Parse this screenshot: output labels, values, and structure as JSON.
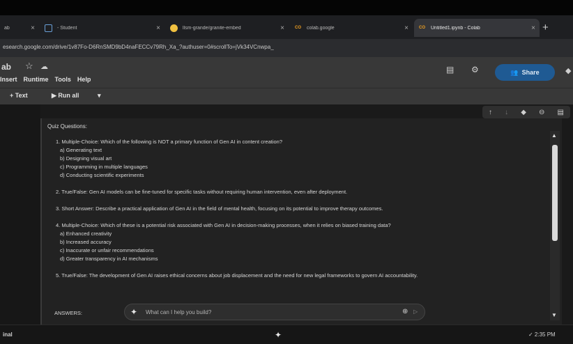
{
  "browser": {
    "tabs": [
      {
        "label": "ab",
        "icon": "tab-icon",
        "active": false
      },
      {
        "label": "- Student",
        "icon": "window-icon",
        "active": false
      },
      {
        "label": "llsm-grande/granite-embed",
        "icon": "people-icon",
        "active": false
      },
      {
        "label": "colab.google",
        "icon": "colab-icon",
        "active": false
      },
      {
        "label": "Untitled1.ipynb - Colab",
        "icon": "colab-icon",
        "active": true
      }
    ],
    "new_tab": "+",
    "url": "esearch.google.com/drive/1v87Fo-D6RnSMD9bD4naFECCv79Rh_Xa_?authuser=0#scrollTo=jVk34VCnwpa_",
    "colors": {
      "active_tab": "#35363a",
      "tabbar": "#1e1f22"
    }
  },
  "colab": {
    "brand": "ab",
    "menu": [
      "Insert",
      "Runtime",
      "Tools",
      "Help"
    ],
    "share_label": "Share",
    "toolbar": {
      "add_text": "+ Text",
      "run_all": "Run all"
    },
    "colors": {
      "share_bg": "#1f5a93"
    }
  },
  "notebook": {
    "title": "Quiz Questions:",
    "questions": [
      {
        "text": "1. Multiple-Choice: Which of the following is NOT a primary function of Gen AI in content creation?",
        "options": [
          "a) Generating text",
          "b) Designing visual art",
          "c) Programming in multiple languages",
          "d) Conducting scientific experiments"
        ]
      },
      {
        "text": "2. True/False: Gen AI models can be fine-tuned for specific tasks without requiring human intervention, even after deployment.",
        "options": []
      },
      {
        "text": "3. Short Answer: Describe a practical application of Gen AI in the field of mental health, focusing on its potential to improve therapy outcomes.",
        "options": []
      },
      {
        "text": "4. Multiple-Choice: Which of these is a potential risk associated with Gen AI in decision-making processes, when it relies on biased training data?",
        "options": [
          "a) Enhanced creativity",
          "b) Increased accuracy",
          "c) Inaccurate or unfair recommendations",
          "d) Greater transparency in AI mechanisms"
        ]
      },
      {
        "text": "5. True/False: The development of Gen AI raises ethical concerns about job displacement and the need for new legal frameworks to govern AI accountability.",
        "options": []
      }
    ],
    "answers_label": "ANSWERS:",
    "prompt_placeholder": "What can I help you build?"
  },
  "statusbar": {
    "left": "inal",
    "time": "✓ 2:35 PM"
  }
}
